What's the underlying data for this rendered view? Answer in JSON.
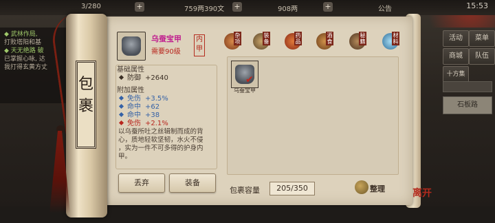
{
  "status_bar": {
    "energy": "3/280",
    "money": "759两390文",
    "gold": "908两",
    "announcement": "公告",
    "time": "15:53"
  },
  "left_panel": {
    "line1": "◆ 武林作局, ",
    "line2": "打败塔阳和基",
    "line3": "◆ 天无绝路 破",
    "line4": "已掌握心咏, 达",
    "line5": "我打得玄黄方丈"
  },
  "right_menu": {
    "activity": "活动",
    "menu": "菜单",
    "shop": "商城",
    "team": "队伍",
    "ten_gang": "十方集",
    "road": "石板路"
  },
  "scroll_title": "包裹",
  "item": {
    "name": "乌蚕宝甲",
    "requirement": "需要90级",
    "seal": "内甲",
    "base_title": "基础属性",
    "base_attrs": [
      {
        "name": "防御",
        "value": "+2640"
      }
    ],
    "extra_title": "附加属性",
    "extra_attrs": [
      {
        "name": "免伤",
        "value": "+3.5%",
        "color": "blue"
      },
      {
        "name": "命中",
        "value": "+62",
        "color": "blue"
      },
      {
        "name": "命中",
        "value": "+38",
        "color": "blue"
      },
      {
        "name": "免伤",
        "value": "+2.1%",
        "color": "red"
      }
    ],
    "description_lines": [
      "以乌蚕所吐之丝辑制而成的背",
      "心，质地轻软坚韧，水火不侵",
      "，实为一件不可多得的护身内",
      "甲。"
    ]
  },
  "buttons": {
    "discard": "丢弃",
    "equip": "装备",
    "sort": "整理"
  },
  "tabs": [
    {
      "label": "杂项",
      "color": "#b4552c"
    },
    {
      "label": "装备",
      "color": "#8a6a3a"
    },
    {
      "label": "药品",
      "color": "#c4582a"
    },
    {
      "label": "酒食",
      "color": "#a86a30"
    },
    {
      "label": "秘籍",
      "color": "#7a5a3c"
    },
    {
      "label": "材料",
      "color": "#5a9fc8"
    }
  ],
  "inventory": {
    "items": [
      {
        "name": "乌蚕宝甲",
        "selected": true
      }
    ],
    "capacity_label": "包裹容量",
    "capacity_value": "205/350"
  },
  "leave_label": "离开"
}
